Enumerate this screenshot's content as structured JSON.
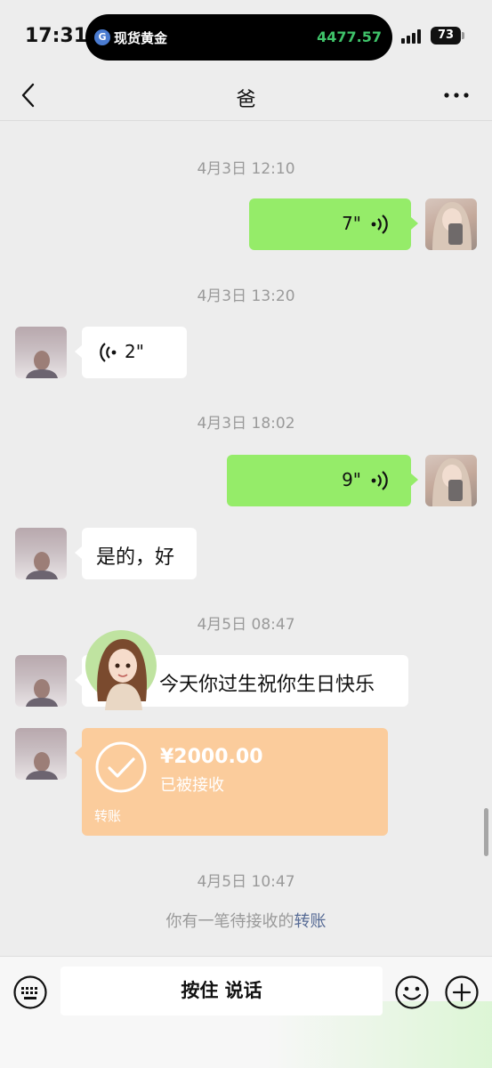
{
  "status_bar": {
    "time": "17:31",
    "island_label": "现货黄金",
    "island_price": "4477.57",
    "battery": "73"
  },
  "nav": {
    "title": "爸",
    "back_icon": "chevron-left-icon",
    "more_icon": "more-dots-icon"
  },
  "messages": [
    {
      "timestamp": "4月3日 12:10"
    },
    {
      "from": "me",
      "type": "voice",
      "duration": "7\""
    },
    {
      "timestamp": "4月3日 13:20"
    },
    {
      "from": "dad",
      "type": "voice",
      "duration": "2\""
    },
    {
      "timestamp": "4月3日 18:02"
    },
    {
      "from": "me",
      "type": "voice",
      "duration": "9\""
    },
    {
      "from": "dad",
      "type": "text",
      "text": "是的，好"
    },
    {
      "timestamp": "4月5日 08:47"
    },
    {
      "from": "dad",
      "type": "text",
      "text": "今天你过生祝你生日快乐"
    },
    {
      "from": "dad",
      "type": "transfer",
      "amount": "¥2000.00",
      "status": "已被接收",
      "label": "转账"
    },
    {
      "timestamp": "4月5日 10:47"
    }
  ],
  "system_note": {
    "text": "你有一笔待接收的",
    "link": "转账"
  },
  "input_bar": {
    "hold_to_talk": "按住 说话",
    "keyboard_icon": "keyboard-icon",
    "emoji_icon": "emoji-icon",
    "plus_icon": "plus-icon"
  },
  "colors": {
    "background": "#ededed",
    "my_bubble": "#95ec69",
    "their_bubble": "#ffffff",
    "transfer_card": "#fbcc9c",
    "link": "#576b95",
    "price_green": "#3fc46a"
  }
}
